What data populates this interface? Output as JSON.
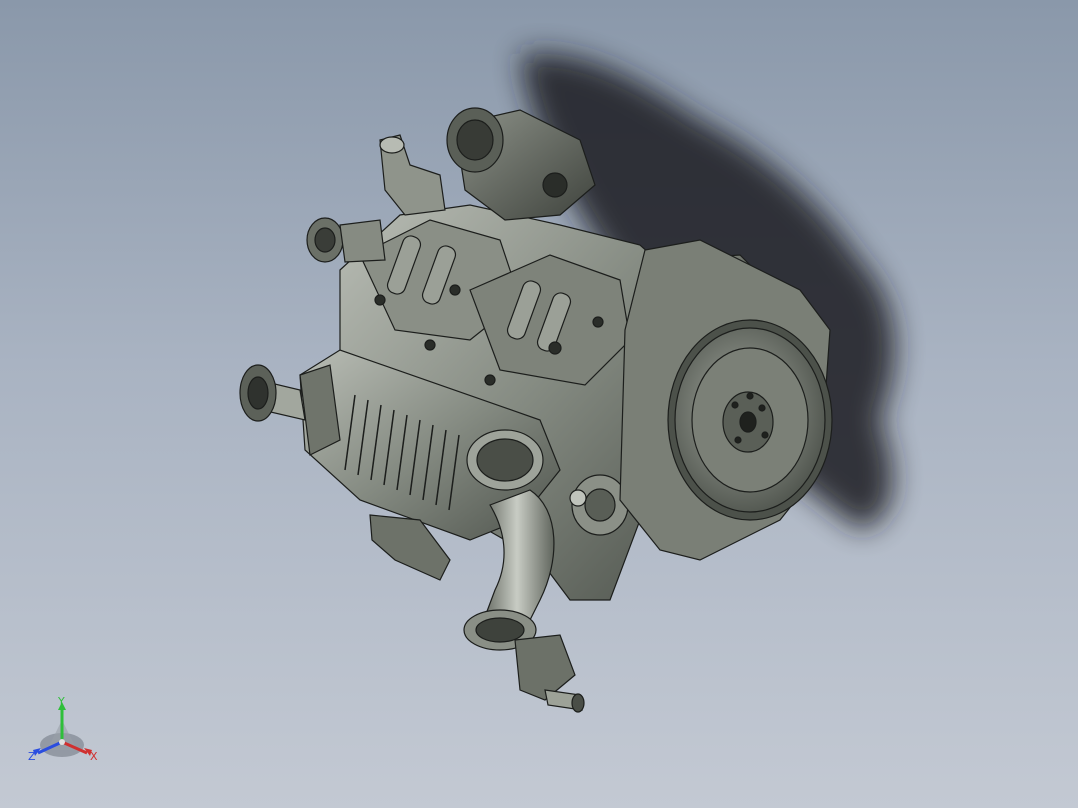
{
  "viewport": {
    "background_top": "#8a98aa",
    "background_bottom": "#c3c9d3"
  },
  "model": {
    "subject": "engine-assembly",
    "body_color": "#7c8279",
    "edge_color": "#1c1e1c",
    "shadow_color": "#1b1d20"
  },
  "triad": {
    "x_label": "X",
    "y_label": "Y",
    "z_label": "Z",
    "x_color": "#d03030",
    "y_color": "#2fbf3a",
    "z_color": "#2a4de0"
  }
}
